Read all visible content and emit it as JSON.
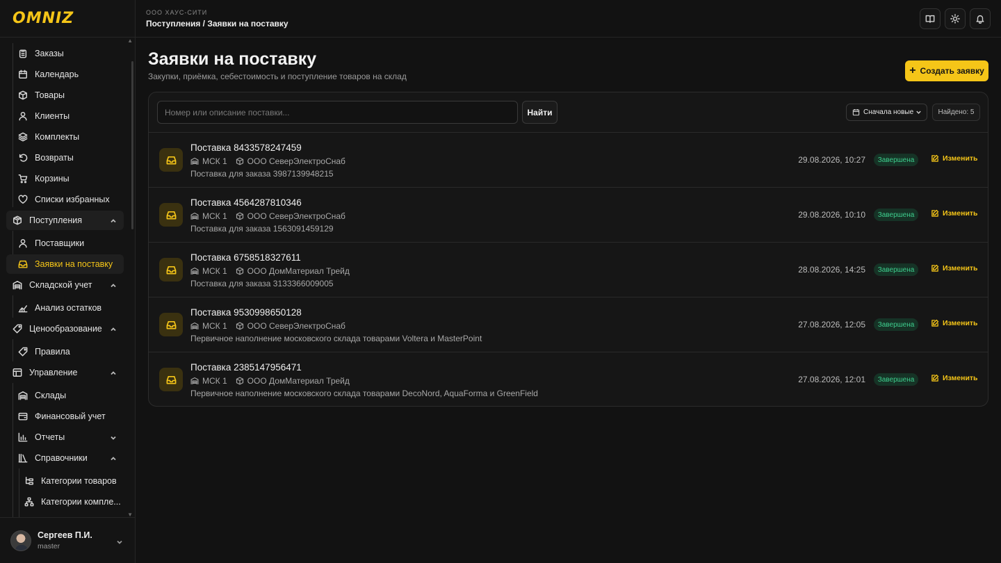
{
  "brand": {
    "logo": "OMNIZ",
    "accent": "#f5c518"
  },
  "topbar": {
    "org": "ООО ХАУС-СИТИ",
    "breadcrumb": "Поступления / Заявки на поставку",
    "actions": [
      "book-icon",
      "sun-icon",
      "bell-icon"
    ]
  },
  "sidebar": {
    "items": [
      {
        "label": "Заказы",
        "icon": "clipboard-icon"
      },
      {
        "label": "Календарь",
        "icon": "calendar-icon"
      },
      {
        "label": "Товары",
        "icon": "box-icon"
      },
      {
        "label": "Клиенты",
        "icon": "user-icon"
      },
      {
        "label": "Комплекты",
        "icon": "layers-icon"
      },
      {
        "label": "Возвраты",
        "icon": "undo-icon"
      },
      {
        "label": "Корзины",
        "icon": "cart-icon"
      },
      {
        "label": "Списки избранных",
        "icon": "heart-icon"
      }
    ],
    "groups": {
      "incoming": {
        "label": "Поступления",
        "children": [
          "Поставщики",
          "Заявки на поставку"
        ]
      },
      "warehouse": {
        "label": "Складской учет",
        "children": [
          "Анализ остатков"
        ]
      },
      "pricing": {
        "label": "Ценообразование",
        "children": [
          "Правила"
        ]
      },
      "management": {
        "label": "Управление",
        "children": [
          "Склады",
          "Финансовый учет",
          "Отчеты",
          "Справочники"
        ],
        "reference_children": [
          "Категории товаров",
          "Категории компле..."
        ]
      }
    },
    "user": {
      "name": "Сергеев П.И.",
      "role": "master"
    }
  },
  "main": {
    "title": "Заявки на поставку",
    "subtitle": "Закупки, приёмка, себестоимость и поступление товаров на склад",
    "create_label": "Создать заявку",
    "search_placeholder": "Номер или описание поставки...",
    "search_value": "",
    "find_label": "Найти",
    "sort_label": "Сначала новые",
    "found_label": "Найдено: 5",
    "edit_label": "Изменить",
    "rows": [
      {
        "title": "Поставка 8433578247459",
        "warehouse": "МСК 1",
        "supplier": "ООО СеверЭлектроСнаб",
        "desc": "Поставка для заказа 3987139948215",
        "date": "29.08.2026, 10:27",
        "status": "Завершена"
      },
      {
        "title": "Поставка 4564287810346",
        "warehouse": "МСК 1",
        "supplier": "ООО СеверЭлектроСнаб",
        "desc": "Поставка для заказа 1563091459129",
        "date": "29.08.2026, 10:10",
        "status": "Завершена"
      },
      {
        "title": "Поставка 6758518327611",
        "warehouse": "МСК 1",
        "supplier": "ООО ДомМатериал Трейд",
        "desc": "Поставка для заказа 3133366009005",
        "date": "28.08.2026, 14:25",
        "status": "Завершена"
      },
      {
        "title": "Поставка 9530998650128",
        "warehouse": "МСК 1",
        "supplier": "ООО СеверЭлектроСнаб",
        "desc": "Первичное наполнение московского склада товарами Voltera и MasterPoint",
        "date": "27.08.2026, 12:05",
        "status": "Завершена"
      },
      {
        "title": "Поставка 2385147956471",
        "warehouse": "МСК 1",
        "supplier": "ООО ДомМатериал Трейд",
        "desc": "Первичное наполнение московского склада товарами DecoNord, AquaForma и GreenField",
        "date": "27.08.2026, 12:01",
        "status": "Завершена"
      }
    ]
  }
}
